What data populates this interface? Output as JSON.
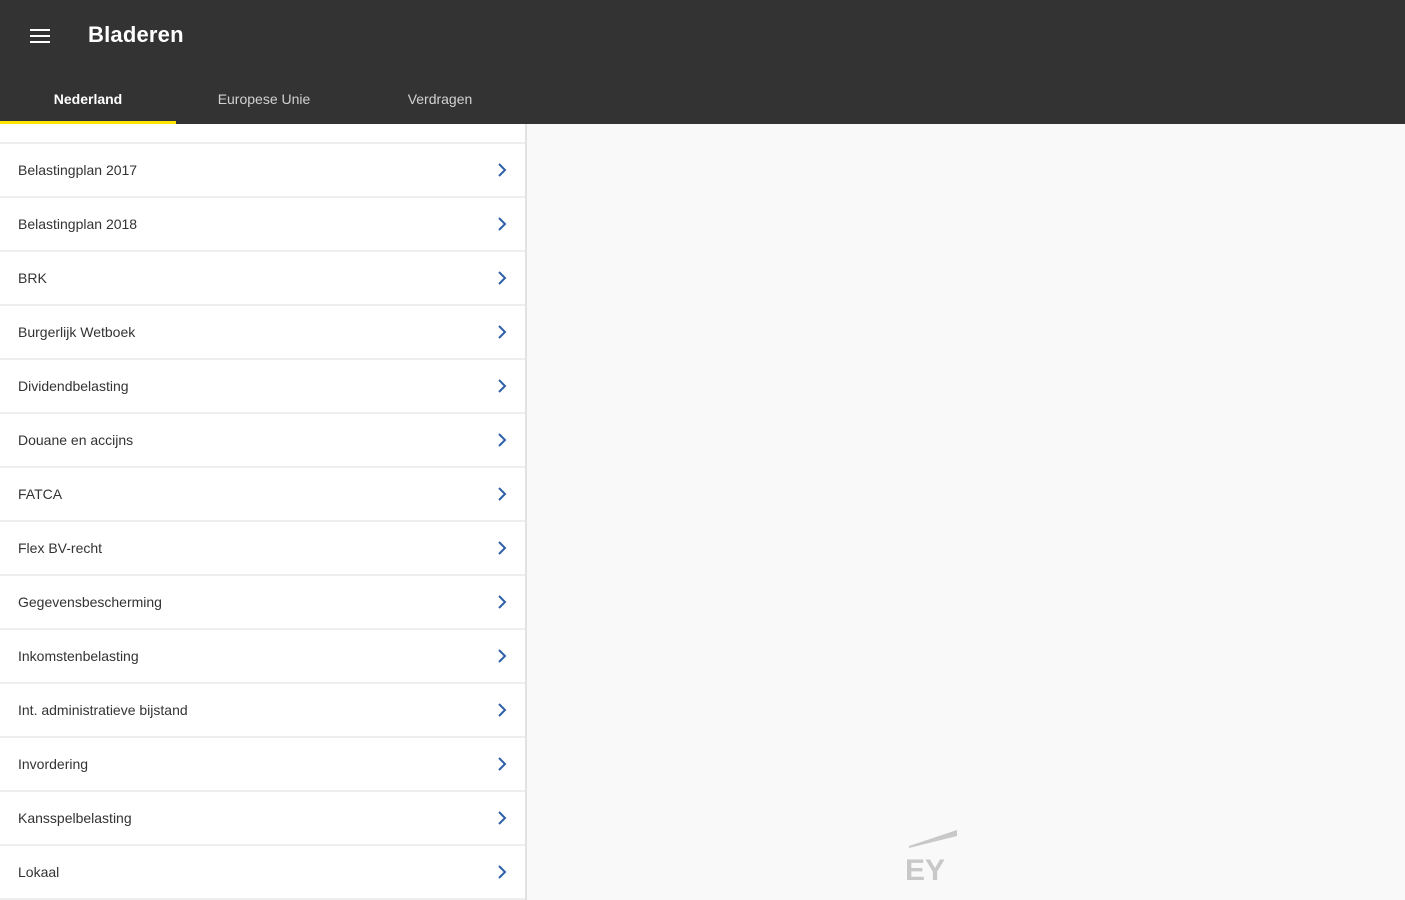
{
  "appbar": {
    "title": "Bladeren",
    "menu_icon": "hamburger-menu-icon"
  },
  "tabs": [
    {
      "label": "Nederland",
      "active": true
    },
    {
      "label": "Europese Unie",
      "active": false
    },
    {
      "label": "Verdragen",
      "active": false
    }
  ],
  "list": {
    "items": [
      {
        "label": "Belastingplan 2017"
      },
      {
        "label": "Belastingplan 2018"
      },
      {
        "label": "BRK"
      },
      {
        "label": "Burgerlijk Wetboek"
      },
      {
        "label": "Dividendbelasting"
      },
      {
        "label": "Douane en accijns"
      },
      {
        "label": "FATCA"
      },
      {
        "label": "Flex BV-recht"
      },
      {
        "label": "Gegevensbescherming"
      },
      {
        "label": "Inkomstenbelasting"
      },
      {
        "label": "Int. administratieve bijstand"
      },
      {
        "label": "Invordering"
      },
      {
        "label": "Kansspelbelasting"
      },
      {
        "label": "Lokaal"
      }
    ],
    "chevron_icon": "chevron-right-icon"
  },
  "detail": {
    "logo_text": "EY"
  },
  "colors": {
    "appbar_bg": "#333333",
    "tab_indicator": "#ffe600",
    "chevron": "#2e5fa8",
    "logo": "#c8c8c8"
  }
}
